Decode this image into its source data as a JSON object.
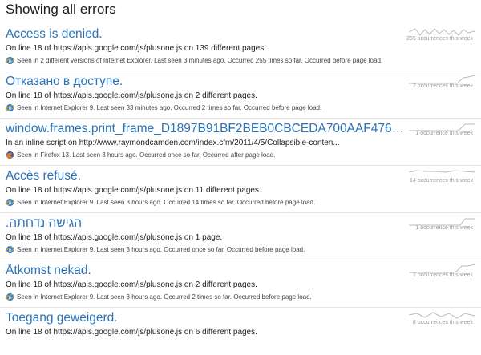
{
  "page": {
    "title": "Showing all errors"
  },
  "errors": [
    {
      "title": "Access is denied.",
      "description": "On line 18 of https://apis.google.com/js/plusone.js on 139 different pages.",
      "meta": "Seen in 2 different versions of Internet Explorer. Last seen 3 minutes ago. Occurred 255 times so far. Occurred before page load.",
      "browser_icon": "internet-explorer-icon",
      "occurrences": "255 occurrences this week"
    },
    {
      "title": "Отказано в доступе.",
      "description": "On line 18 of https://apis.google.com/js/plusone.js on 2 different pages.",
      "meta": "Seen in Internet Explorer 9. Last seen 33 minutes ago. Occurred 2 times so far. Occurred before page load.",
      "browser_icon": "internet-explorer-icon",
      "occurrences": "2 occurrences this week"
    },
    {
      "title": "window.frames.print_frame_D1897B91BF2BEB0CBCEDA700AAF476C4 is...",
      "description": "In an inline script on http://www.raymondcamden.com/index.cfm/2011/4/5/Collapsible-conten...",
      "meta": "Seen in Firefox 13. Last seen 3 hours ago. Occurred once so far. Occurred after page load.",
      "browser_icon": "firefox-icon",
      "occurrences": "1 occurrence this week"
    },
    {
      "title": "Accès refusé.",
      "description": "On line 18 of https://apis.google.com/js/plusone.js on 11 different pages.",
      "meta": "Seen in Internet Explorer 9. Last seen 3 hours ago. Occurred 14 times so far. Occurred before page load.",
      "browser_icon": "internet-explorer-icon",
      "occurrences": "14 occurrences this week"
    },
    {
      "title": "הגישה נדחתה.",
      "description": "On line 18 of https://apis.google.com/js/plusone.js on 1 page.",
      "meta": "Seen in Internet Explorer 9. Last seen 3 hours ago. Occurred once so far. Occurred before page load.",
      "browser_icon": "internet-explorer-icon",
      "occurrences": "1 occurrence this week"
    },
    {
      "title": "Åtkomst nekad.",
      "description": "On line 18 of https://apis.google.com/js/plusone.js on 2 different pages.",
      "meta": "Seen in Internet Explorer 9. Last seen 3 hours ago. Occurred 2 times so far. Occurred before page load.",
      "browser_icon": "internet-explorer-icon",
      "occurrences": "2 occurrences this week"
    },
    {
      "title": "Toegang geweigerd.",
      "description": "On line 18 of https://apis.google.com/js/plusone.js on 6 different pages.",
      "meta": "",
      "browser_icon": "internet-explorer-icon",
      "occurrences": "8 occurrences this week"
    }
  ],
  "colors": {
    "title_link": "#2a73b8",
    "sparkline": "#bbbbbb",
    "divider": "#e6e6e6"
  }
}
